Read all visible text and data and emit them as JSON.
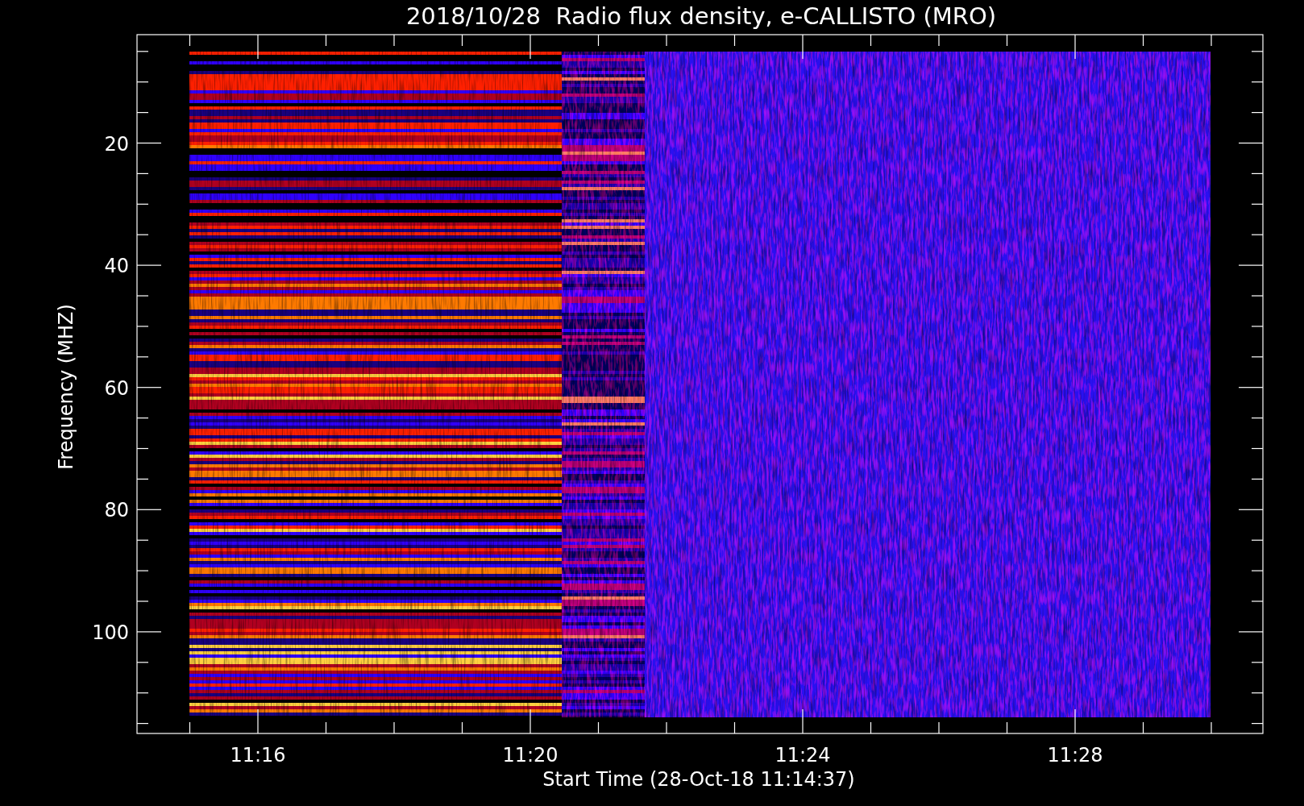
{
  "title": "2018/10/28  Radio flux density, e-CALLISTO (MRO)",
  "y_axis": {
    "label": "Frequency (MHZ)",
    "ticks": [
      "20",
      "40",
      "60",
      "80",
      "100"
    ]
  },
  "x_axis": {
    "label": "Start Time (28-Oct-18 11:14:37)",
    "ticks": [
      "11:16",
      "11:20",
      "11:24",
      "11:28"
    ]
  }
}
